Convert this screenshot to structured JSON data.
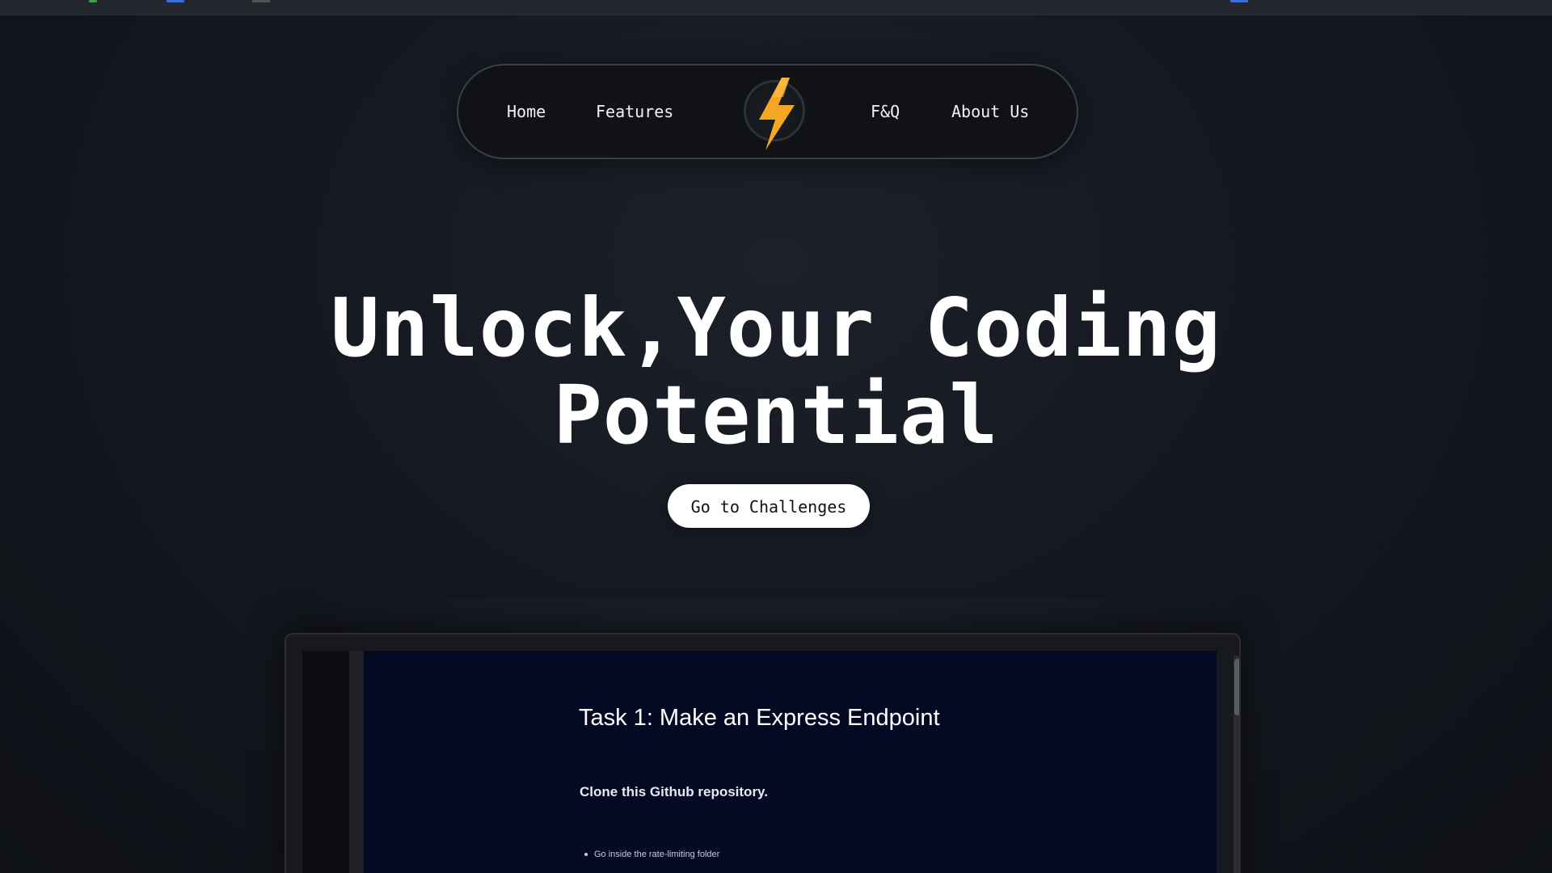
{
  "nav": {
    "links": [
      {
        "label": "Home"
      },
      {
        "label": "Features"
      },
      {
        "label": "F&Q"
      },
      {
        "label": "About Us"
      }
    ],
    "logo_icon": "lightning-bolt-icon"
  },
  "hero": {
    "title_line1": "Unlock,Your Coding",
    "title_line2": "Potential",
    "cta_label": "Go to Challenges"
  },
  "preview": {
    "task_title": "Task 1: Make an Express Endpoint",
    "step_text": "Clone this Github repository.",
    "bullet_text": "Go inside the rate-limiting folder"
  },
  "colors": {
    "background": "#151820",
    "nav_background": "#101216",
    "accent_bolt": "#f5a623",
    "preview_doc": "#050a24",
    "cta_background": "#ffffff"
  }
}
